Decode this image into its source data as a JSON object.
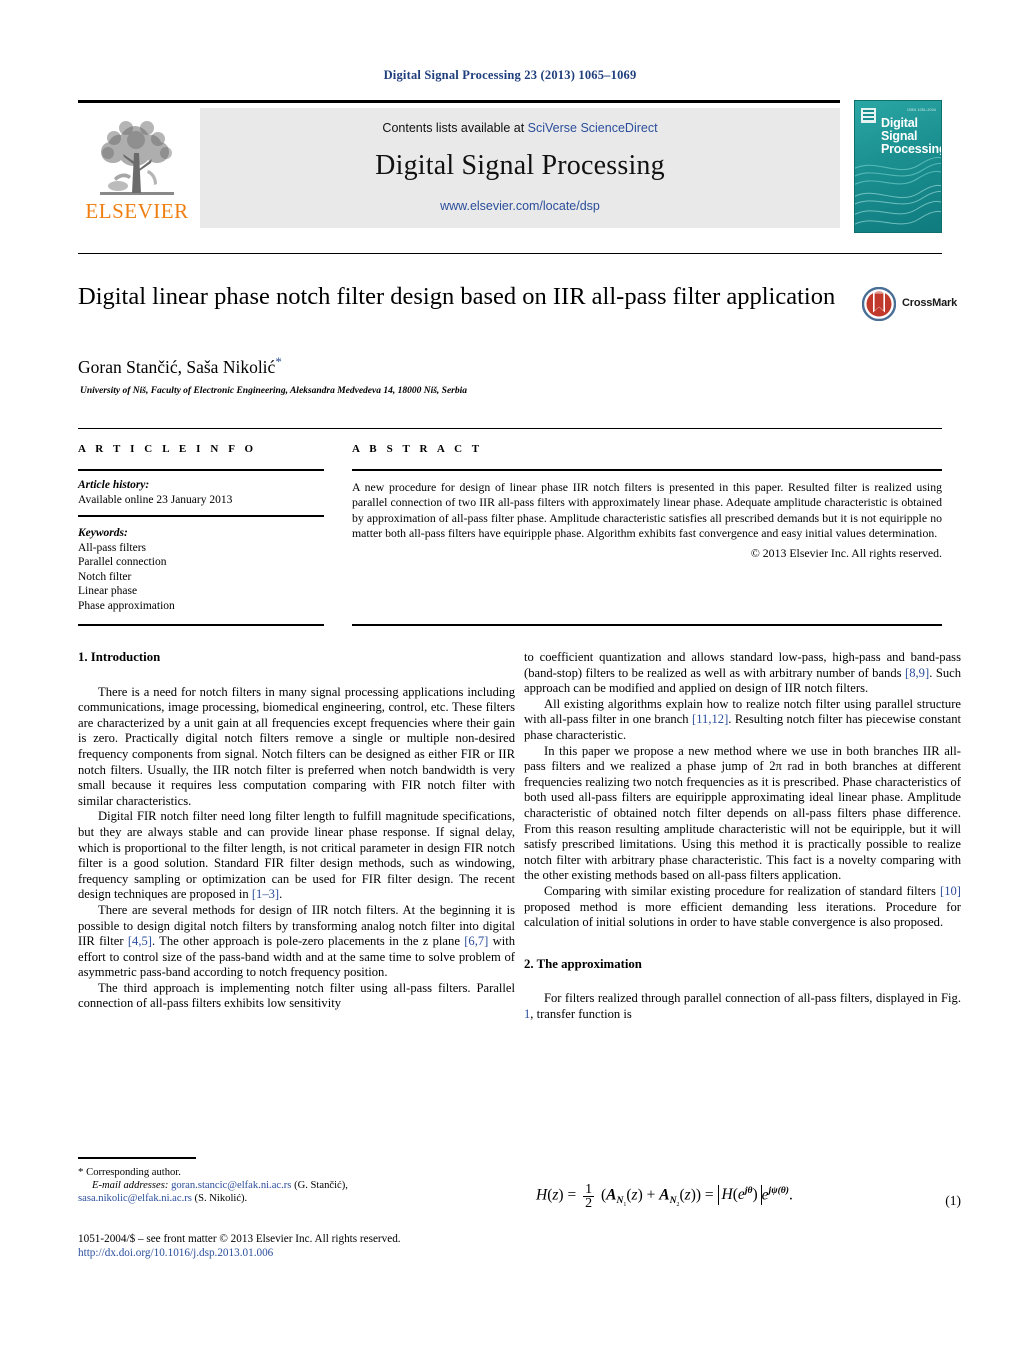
{
  "running_head": "Digital Signal Processing 23 (2013) 1065–1069",
  "masthead": {
    "contents_prefix": "Contents lists available at ",
    "contents_link": "SciVerse ScienceDirect",
    "journal_title": "Digital Signal Processing",
    "journal_url": "www.elsevier.com/locate/dsp",
    "publisher": "ELSEVIER",
    "cover_title_line1": "Digital",
    "cover_title_line2": "Signal",
    "cover_title_line3": "Processing",
    "cover_issn": "ISSN 1051-2004"
  },
  "article": {
    "title": "Digital linear phase notch filter design based on IIR all-pass filter application",
    "authors": "Goran Stančić, Saša Nikolić",
    "author_marker": "*",
    "affiliation": "University of Niš, Faculty of Electronic Engineering, Aleksandra Medvedeva 14, 18000 Niš, Serbia",
    "crossmark_label": "CrossMark"
  },
  "info": {
    "heading": "A R T I C L E   I N F O",
    "history_label": "Article history:",
    "history_value": "Available online 23 January 2013",
    "keywords_label": "Keywords:",
    "keywords": [
      "All-pass filters",
      "Parallel connection",
      "Notch filter",
      "Linear phase",
      "Phase approximation"
    ]
  },
  "abstract": {
    "heading": "A B S T R A C T",
    "text": "A new procedure for design of linear phase IIR notch filters is presented in this paper. Resulted filter is realized using parallel connection of two IIR all-pass filters with approximately linear phase. Adequate amplitude characteristic is obtained by approximation of all-pass filter phase. Amplitude characteristic satisfies all prescribed demands but it is not equiripple no matter both all-pass filters have equiripple phase. Algorithm exhibits fast convergence and easy initial values determination.",
    "copyright": "© 2013 Elsevier Inc. All rights reserved."
  },
  "body": {
    "section1_heading": "1. Introduction",
    "section2_heading": "2. The approximation",
    "left_paragraphs": [
      "There is a need for notch filters in many signal processing applications including communications, image processing, biomedical engineering, control, etc. These filters are characterized by a unit gain at all frequencies except frequencies where their gain is zero. Practically digital notch filters remove a single or multiple non-desired frequency components from signal. Notch filters can be designed as either FIR or IIR notch filters. Usually, the IIR notch filter is preferred when notch bandwidth is very small because it requires less computation comparing with FIR notch filter with similar characteristics.",
      "Digital FIR notch filter need long filter length to fulfill magnitude specifications, but they are always stable and can provide linear phase response. If signal delay, which is proportional to the filter length, is not critical parameter in design FIR notch filter is a good solution. Standard FIR filter design methods, such as windowing, frequency sampling or optimization can be used for FIR filter design. The recent design techniques are proposed in ",
      "There are several methods for design of IIR notch filters. At the beginning it is possible to design digital notch filters by transforming analog notch filter into digital IIR filter ",
      "The third approach is implementing notch filter using all-pass filters. Parallel connection of all-pass filters exhibits low sensitivity"
    ],
    "left_refs": {
      "r1_3": "[1–3]",
      "r4_5": "[4,5]",
      "r6_7": "[6,7]"
    },
    "left_p2_tail": ".",
    "left_p3_mid": ". The other approach is pole-zero placements in the z plane ",
    "left_p3_tail": " with effort to control size of the pass-band width and at the same time to solve problem of asymmetric pass-band according to notch frequency position.",
    "right_paragraphs": [
      "to coefficient quantization and allows standard low-pass, high-pass and band-pass (band-stop) filters to be realized as well as with arbitrary number of bands ",
      "All existing algorithms explain how to realize notch filter using parallel structure with all-pass filter in one branch ",
      "In this paper we propose a new method where we use in both branches IIR all-pass filters and we realized a phase jump of 2π rad in both branches at different frequencies realizing two notch frequencies as it is prescribed. Phase characteristics of both used all-pass filters are equiripple approximating ideal linear phase. Amplitude characteristic of obtained notch filter depends on all-pass filters phase difference. From this reason resulting amplitude characteristic will not be equiripple, but it will satisfy prescribed limitations. Using this method it is practically possible to realize notch filter with arbitrary phase characteristic. This fact is a novelty comparing with the other existing methods based on all-pass filters application.",
      "Comparing with similar existing procedure for realization of standard filters "
    ],
    "right_refs": {
      "r8_9": "[8,9]",
      "r11_12": "[11,12]",
      "r10": "[10]"
    },
    "right_p1_tail": ". Such approach can be modified and applied on design of IIR notch filters.",
    "right_p2_tail": ". Resulting notch filter has piecewise constant phase characteristic.",
    "right_p4_tail": " proposed method is more efficient demanding less iterations. Procedure for calculation of initial solutions in order to have stable convergence is also proposed.",
    "section2_intro_a": "For filters realized through parallel connection of all-pass filters, displayed in Fig. ",
    "section2_fig_ref": "1",
    "section2_intro_b": ", transfer function is"
  },
  "equation": {
    "number": "(1)"
  },
  "footnotes": {
    "corresponding_marker": "*",
    "corresponding_text": "Corresponding author.",
    "email_label": "E-mail addresses:",
    "email1": "goran.stancic@elfak.ni.ac.rs",
    "email1_owner": " (G. Stančić),",
    "email2": "sasa.nikolic@elfak.ni.ac.rs",
    "email2_owner": " (S. Nikolić)."
  },
  "imprint": {
    "line1": "1051-2004/$ – see front matter © 2013 Elsevier Inc. All rights reserved.",
    "doi": "http://dx.doi.org/10.1016/j.dsp.2013.01.006"
  },
  "colors": {
    "link": "#2b4e9b",
    "runhead": "#1f3e7c",
    "elsevier_orange": "#f07f13",
    "cover_teal": "#178c8c",
    "masthead_grey": "#e9e9e9"
  }
}
